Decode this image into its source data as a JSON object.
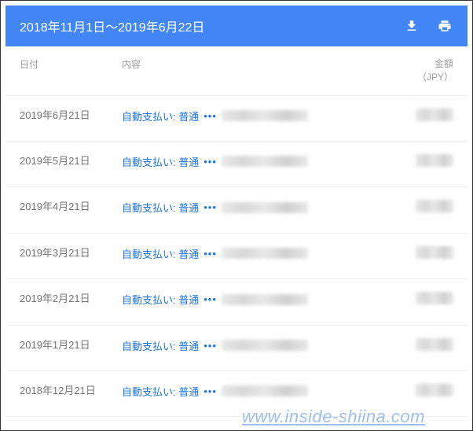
{
  "header": {
    "title": "2018年11月1日～2019年6月22日"
  },
  "columns": {
    "date": "日付",
    "content": "内容",
    "amount_line1": "金額",
    "amount_line2": "（JPY）"
  },
  "rows": [
    {
      "date": "2019年6月21日",
      "payment_label": "自動支払い: 普通"
    },
    {
      "date": "2019年5月21日",
      "payment_label": "自動支払い: 普通"
    },
    {
      "date": "2019年4月21日",
      "payment_label": "自動支払い: 普通"
    },
    {
      "date": "2019年3月21日",
      "payment_label": "自動支払い: 普通"
    },
    {
      "date": "2019年2月21日",
      "payment_label": "自動支払い: 普通"
    },
    {
      "date": "2019年1月21日",
      "payment_label": "自動支払い: 普通"
    },
    {
      "date": "2018年12月21日",
      "payment_label": "自動支払い: 普通"
    }
  ],
  "watermark": "www.inside-shiina.com"
}
